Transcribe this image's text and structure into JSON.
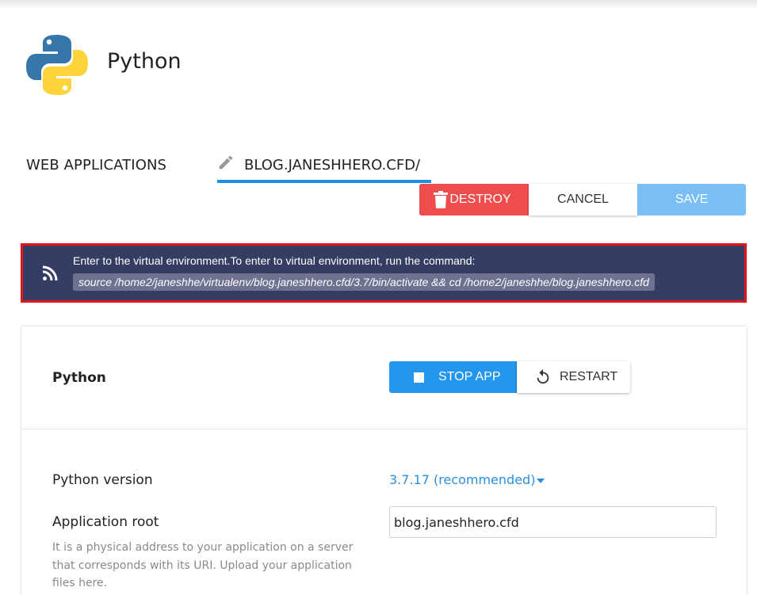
{
  "app": {
    "title": "Python",
    "logo_icon": "python-logo-icon"
  },
  "tabs": {
    "web_applications": "WEB APPLICATIONS",
    "domain": "BLOG.JANESHHERO.CFD/",
    "edit_icon": "pencil-icon"
  },
  "actions": {
    "destroy": "DESTROY",
    "cancel": "CANCEL",
    "save": "SAVE"
  },
  "alert": {
    "icon": "rss-icon",
    "message": "Enter to the virtual environment.To enter to virtual environment, run the command:",
    "command": "source /home2/janeshhe/virtualenv/blog.janeshhero.cfd/3.7/bin/activate && cd /home2/janeshhe/blog.janeshhero.cfd"
  },
  "card": {
    "title": "Python",
    "stop_app": "STOP APP",
    "restart": "RESTART",
    "python_version_label": "Python version",
    "python_version_value": "3.7.17 (recommended)",
    "app_root_label": "Application root",
    "app_root_value": "blog.janeshhero.cfd",
    "app_root_help": "It is a physical address to your application on a server that corresponds with its URI. Upload your application files here."
  },
  "colors": {
    "accent": "#2596ee",
    "danger": "#ee4d4d",
    "alert_bg": "#353d62",
    "highlight_border": "#e0161d",
    "save_disabled": "#79bff5"
  }
}
